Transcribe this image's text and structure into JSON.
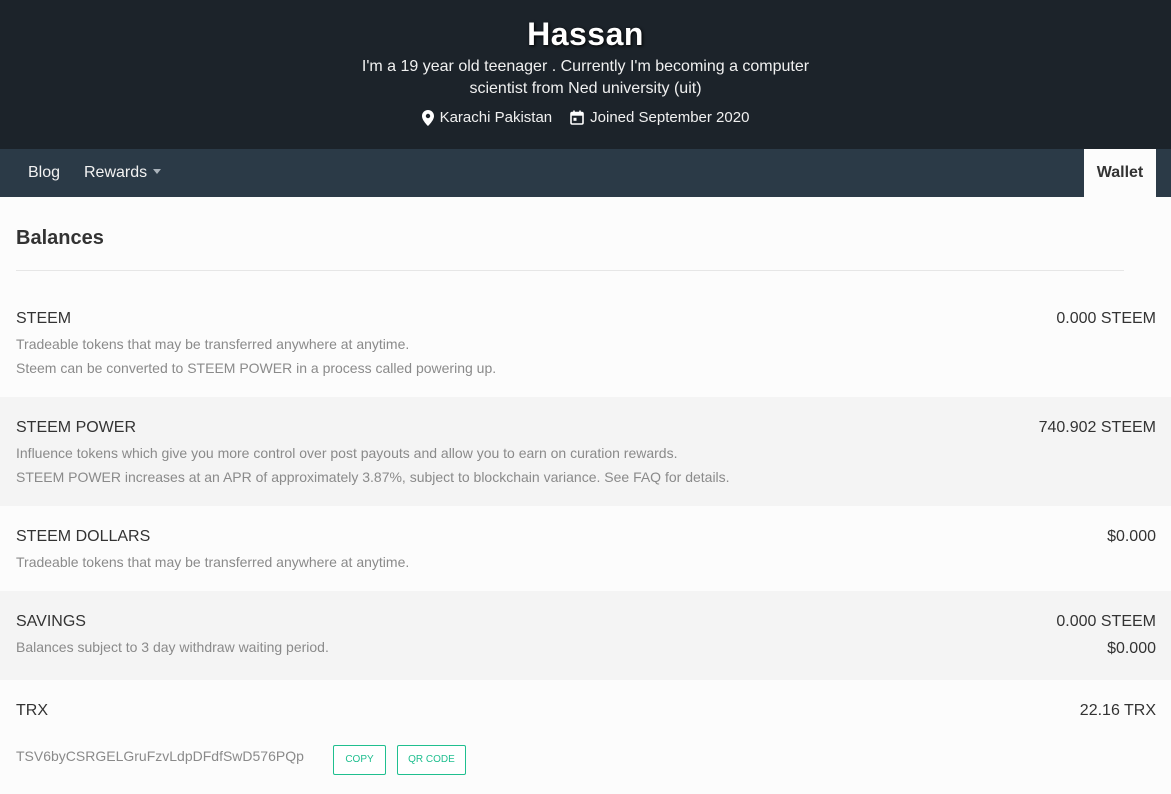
{
  "profile": {
    "name": "Hassan",
    "about": "I'm a 19 year old teenager . Currently I'm becoming a computer scientist from Ned university (uit)",
    "location": "Karachi Pakistan",
    "joined": "Joined September 2020",
    "icons": {
      "location": "map-pin-icon",
      "joined": "calendar-icon"
    }
  },
  "nav": {
    "blog": "Blog",
    "rewards": "Rewards",
    "wallet": "Wallet"
  },
  "balances": {
    "title": "Balances",
    "steem": {
      "name": "STEEM",
      "desc1": "Tradeable tokens that may be transferred anywhere at anytime.",
      "desc2": "Steem can be converted to STEEM POWER in a process called powering up.",
      "value": "0.000 STEEM"
    },
    "steem_power": {
      "name": "STEEM POWER",
      "desc1": "Influence tokens which give you more control over post payouts and allow you to earn on curation rewards.",
      "desc2": "STEEM POWER increases at an APR of approximately 3.87%, subject to blockchain variance. See FAQ for details.",
      "value": "740.902 STEEM"
    },
    "steem_dollars": {
      "name": "STEEM DOLLARS",
      "desc1": "Tradeable tokens that may be transferred anywhere at anytime.",
      "value": "$0.000"
    },
    "savings": {
      "name": "SAVINGS",
      "desc1": "Balances subject to 3 day withdraw waiting period.",
      "value_steem": "0.000 STEEM",
      "value_dollars": "$0.000"
    },
    "trx": {
      "name": "TRX",
      "value": "22.16 TRX",
      "address": "TSV6byCSRGELGruFzvLdpDFdfSwD576PQp",
      "copy_label": "COPY",
      "qr_label": "QR CODE"
    }
  },
  "colors": {
    "header_bg": "#1c232a",
    "navbar_bg": "#2b3a47",
    "accent": "#1fbf8f",
    "row_shade": "#f4f4f4"
  }
}
